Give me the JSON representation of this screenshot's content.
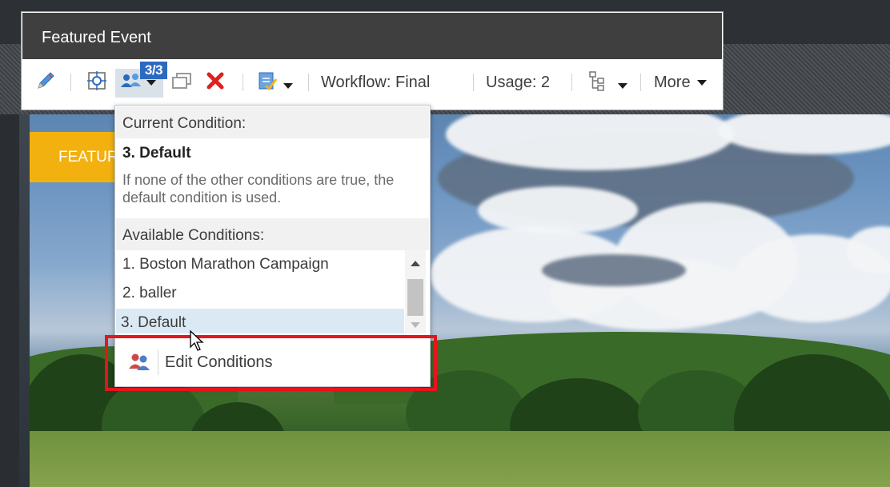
{
  "window": {
    "title": "Featured Event"
  },
  "toolbar": {
    "condition_badge": "3/3",
    "workflow_label": "Workflow: Final",
    "usage_label": "Usage: 2",
    "more_label": "More",
    "icons": [
      "pencil-icon",
      "target-icon",
      "personalization-icon",
      "window-icon",
      "delete-icon",
      "checklist-icon",
      "tree-icon"
    ]
  },
  "background": {
    "featured_badge": "FEATUR"
  },
  "conditions_dropdown": {
    "current_heading": "Current Condition:",
    "current_name": "3. Default",
    "current_description": "If none of the other conditions are true, the default condition is used.",
    "available_heading": "Available Conditions:",
    "items": [
      {
        "label": "1. Boston Marathon Campaign",
        "selected": false
      },
      {
        "label": "2. baller",
        "selected": false
      },
      {
        "label": "3. Default",
        "selected": true
      }
    ],
    "edit_label": "Edit Conditions"
  },
  "colors": {
    "header_bg": "#3f3f3f",
    "badge_bg": "#2c6ac0",
    "highlight": "#e2161d",
    "selected_row": "#dbe9f4",
    "featured_badge_bg": "#f3b10f"
  }
}
